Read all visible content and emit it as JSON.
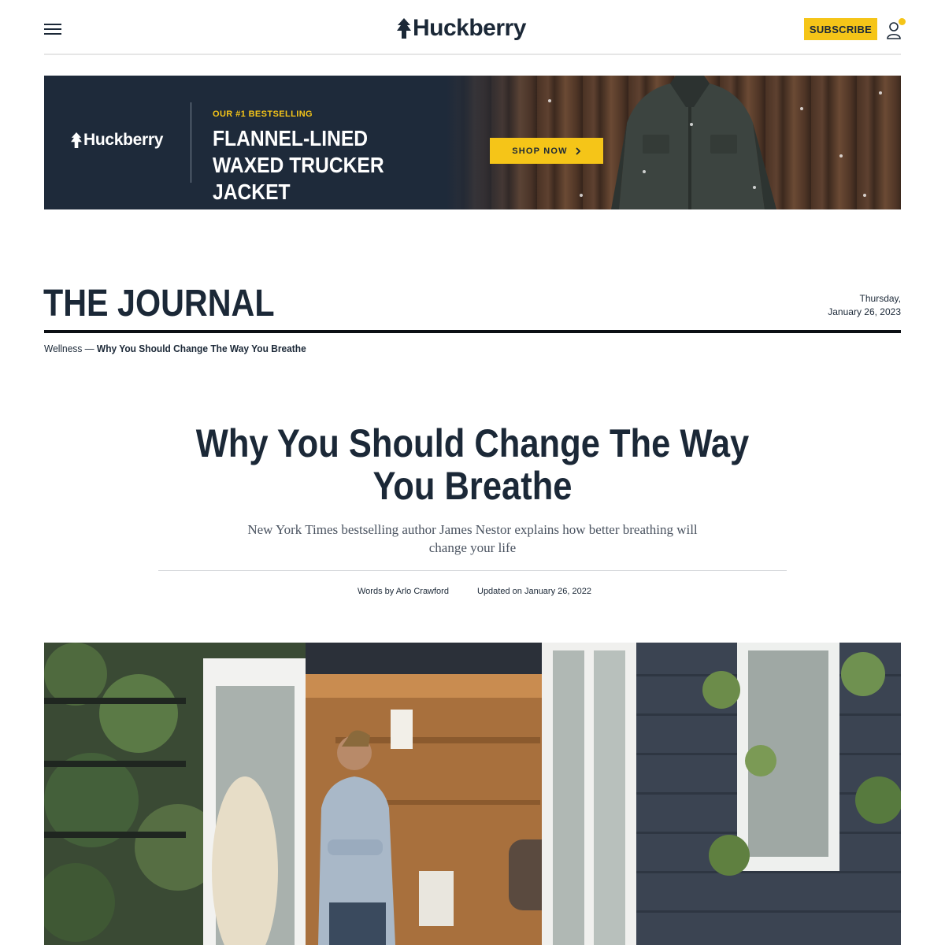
{
  "header": {
    "menu_icon": "hamburger-menu-icon",
    "logo_text": "Huckberry",
    "logo_icon": "pine-tree-icon",
    "subscribe_label": "SUBSCRIBE",
    "account_icon": "user-icon",
    "brand_yellow": "#f5c518",
    "brand_navy": "#1b2837"
  },
  "promo": {
    "logo_text": "Huckberry",
    "eyebrow": "OUR #1 BESTSELLING",
    "headline_line1": "FLANNEL-LINED",
    "headline_line2": "WAXED TRUCKER JACKET",
    "cta_label": "SHOP NOW",
    "cta_icon": "chevron-right-icon",
    "background": "#1e2a3a"
  },
  "journal": {
    "title": "THE JOURNAL",
    "date_line1": "Thursday,",
    "date_line2": "January 26, 2023"
  },
  "breadcrumb": {
    "category": "Wellness",
    "separator": " — ",
    "current": "Why You Should Change The Way You Breathe"
  },
  "article": {
    "title": "Why You Should Change The Way You Breathe",
    "dek": "New York Times bestselling author James Nestor explains how better breathing will change your life",
    "byline_prefix": "Words by",
    "author": "Arlo Crawford",
    "updated_prefix": "Updated on",
    "updated_date": "January 26, 2022"
  }
}
